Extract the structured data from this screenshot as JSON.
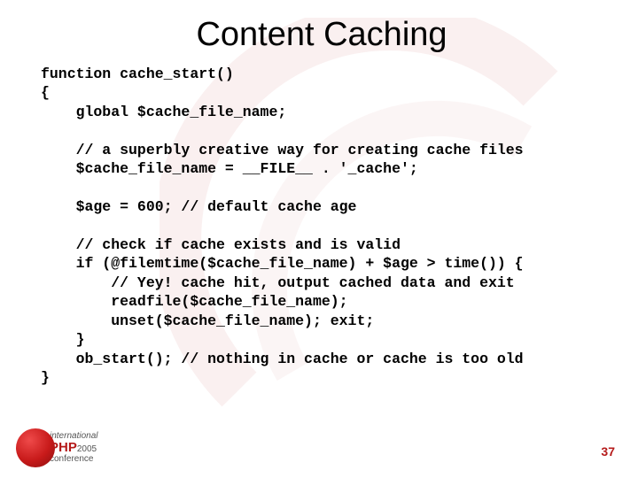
{
  "title": "Content Caching",
  "code": {
    "l1": "function cache_start()",
    "l2": "{",
    "l3": "    global $cache_file_name;",
    "l4": "",
    "l5": "    // a superbly creative way for creating cache files",
    "l6": "    $cache_file_name = __FILE__ . '_cache';",
    "l7": "",
    "l8": "    $age = 600; // default cache age",
    "l9": "",
    "l10": "    // check if cache exists and is valid",
    "l11": "    if (@filemtime($cache_file_name) + $age > time()) {",
    "l12": "        // Yey! cache hit, output cached data and exit",
    "l13": "        readfile($cache_file_name);",
    "l14": "        unset($cache_file_name); exit;",
    "l15": "    }",
    "l16": "    ob_start(); // nothing in cache or cache is too old",
    "l17": "}"
  },
  "logo": {
    "line1": "international",
    "php": "PHP",
    "year": "2005",
    "line3": "conference"
  },
  "page_number": "37"
}
